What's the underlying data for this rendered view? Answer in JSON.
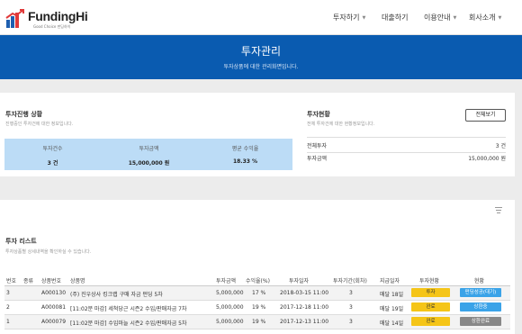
{
  "header": {
    "brand": "FundingHi",
    "tagline": "Good Choice 펀딩하이",
    "nav": [
      {
        "label": "투자하기",
        "has_dropdown": true
      },
      {
        "label": "대출하기",
        "has_dropdown": false
      },
      {
        "label": "이용안내",
        "has_dropdown": true
      },
      {
        "label": "회사소개",
        "has_dropdown": true
      }
    ],
    "caret": "▼"
  },
  "hero": {
    "title": "투자관리",
    "subtitle": "투자상품에 대한 관리화면입니다."
  },
  "progress": {
    "title": "투자진행 상황",
    "subtitle": "진행중인 투자건에 대한 정보입니다.",
    "stats": [
      {
        "label": "투자건수",
        "value": "3 건"
      },
      {
        "label": "투자금액",
        "value": "15,000,000 원"
      },
      {
        "label": "평균 수익율",
        "value": "18.33 %"
      }
    ]
  },
  "status": {
    "title": "투자현황",
    "subtitle": "전체 투자건에 대한 현황정보입니다.",
    "view_all": "전체보기",
    "rows": [
      {
        "label": "전체투자",
        "value": "3 건"
      },
      {
        "label": "투자금액",
        "value": "15,000,000 원"
      }
    ]
  },
  "list": {
    "title": "투자 리스트",
    "subtitle": "투자상품별 상세내역을 확인하실 수 있습니다.",
    "columns": [
      "번호",
      "종류",
      "상품번호",
      "상품명",
      "투자금액",
      "수익율(%)",
      "투자일자",
      "투자기간(회차)",
      "지급일자",
      "투자현황",
      "현황"
    ],
    "rows": [
      {
        "no": "3",
        "type": "",
        "product_id": "A000130",
        "name": "(주) 진우상사 킹크랩 구매 자금 펀딩 5차",
        "amount": "5,000,000",
        "rate": "17 %",
        "date": "2018-03-15 11:00",
        "period": "3",
        "pay_day": "매달 18일",
        "invest_status": "투자",
        "status": "펀딩성공(대기)",
        "status_color": "#3aa3e8"
      },
      {
        "no": "2",
        "type": "",
        "product_id": "A000081",
        "name": "[11:02분 마감] 세척당근 시즌2 수입/판매자금 7차",
        "amount": "5,000,000",
        "rate": "19 %",
        "date": "2017-12-18 11:00",
        "period": "3",
        "pay_day": "매달 19일",
        "invest_status": "완료",
        "status": "상환중",
        "status_color": "#3aa3e8"
      },
      {
        "no": "1",
        "type": "",
        "product_id": "A000079",
        "name": "[11:02분 마감] 수입마늘 시즌2 수입/판매자금 5차",
        "amount": "5,000,000",
        "rate": "19 %",
        "date": "2017-12-13 11:00",
        "period": "3",
        "pay_day": "매달 14일",
        "invest_status": "완료",
        "status": "상환완료",
        "status_color": "#888888"
      }
    ]
  },
  "colors": {
    "primary": "#0a5bb0",
    "stat_box": "#bcdcf6",
    "badge_yellow": "#f5c518"
  }
}
